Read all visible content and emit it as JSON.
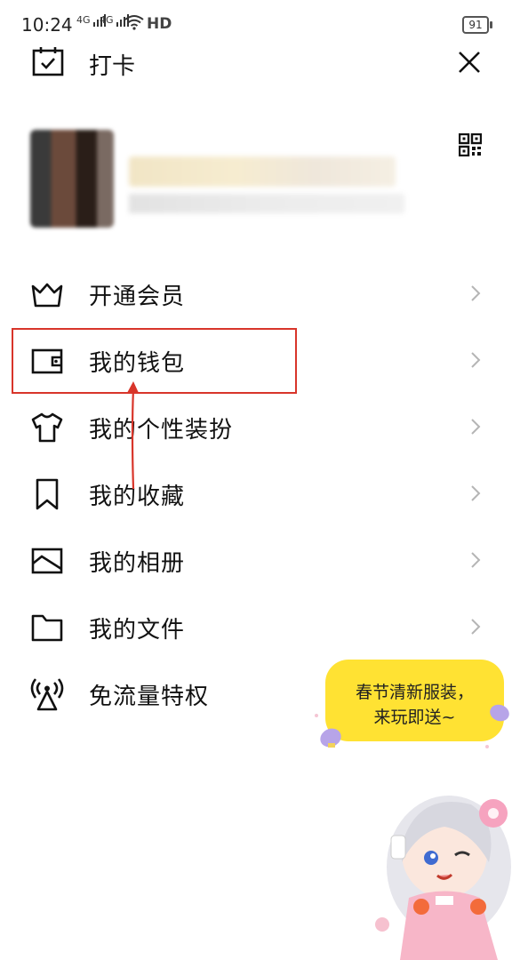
{
  "status_bar": {
    "time": "10:24",
    "signal1": "4G",
    "signal2": "4G",
    "hd": "HD",
    "battery": "91"
  },
  "header": {
    "title": "打卡"
  },
  "menu": [
    {
      "label": "开通会员",
      "icon": "crown-icon"
    },
    {
      "label": "我的钱包",
      "icon": "wallet-icon"
    },
    {
      "label": "我的个性装扮",
      "icon": "tshirt-icon"
    },
    {
      "label": "我的收藏",
      "icon": "bookmark-icon"
    },
    {
      "label": "我的相册",
      "icon": "photo-icon"
    },
    {
      "label": "我的文件",
      "icon": "folder-icon"
    },
    {
      "label": "免流量特权",
      "icon": "signal-tower-icon"
    }
  ],
  "promo": {
    "line1": "春节清新服装，",
    "line2": "来玩即送~"
  },
  "colors": {
    "highlight": "#d8352a",
    "promo_bg": "#ffe233"
  }
}
